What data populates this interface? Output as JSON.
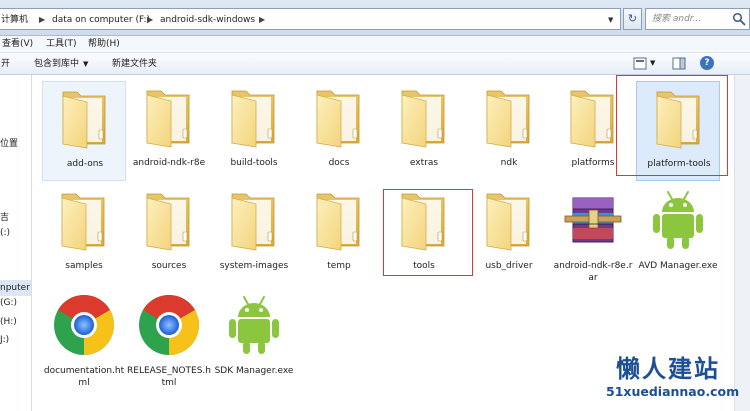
{
  "address_bar": {
    "crumbs": [
      "计算机",
      "data on computer (F:)",
      "android-sdk-windows"
    ],
    "search_placeholder": "搜索 andr..."
  },
  "menu": {
    "items": [
      "查看(V)",
      "工具(T)",
      "帮助(H)"
    ]
  },
  "command_bar": {
    "open_label": "开",
    "include_label": "包含到库中",
    "new_folder_label": "新建文件夹"
  },
  "nav_pane": {
    "items": [
      "位置",
      "吉",
      "(:)",
      "nputer",
      "(G:)",
      "(H:)",
      "J:)"
    ]
  },
  "files": [
    {
      "label": "add-ons",
      "type": "folder"
    },
    {
      "label": "android-ndk-r8e",
      "type": "folder"
    },
    {
      "label": "build-tools",
      "type": "folder"
    },
    {
      "label": "docs",
      "type": "folder"
    },
    {
      "label": "extras",
      "type": "folder"
    },
    {
      "label": "ndk",
      "type": "folder"
    },
    {
      "label": "platforms",
      "type": "folder"
    },
    {
      "label": "platform-tools",
      "type": "folder"
    },
    {
      "label": "samples",
      "type": "folder"
    },
    {
      "label": "sources",
      "type": "folder"
    },
    {
      "label": "system-images",
      "type": "folder"
    },
    {
      "label": "temp",
      "type": "folder"
    },
    {
      "label": "tools",
      "type": "folder"
    },
    {
      "label": "usb_driver",
      "type": "folder"
    },
    {
      "label": "android-ndk-r8e.rar",
      "type": "rar"
    },
    {
      "label": "AVD Manager.exe",
      "type": "android"
    },
    {
      "label": "documentation.html",
      "type": "chrome"
    },
    {
      "label": "RELEASE_NOTES.html",
      "type": "chrome"
    },
    {
      "label": "SDK Manager.exe",
      "type": "android"
    }
  ],
  "watermark": {
    "cn": "懒人建站",
    "en": "51xuediannao.com"
  },
  "colors": {
    "highlight_box": "#e53232",
    "selection": "#dceafb",
    "watermark": "#1d4f94"
  }
}
